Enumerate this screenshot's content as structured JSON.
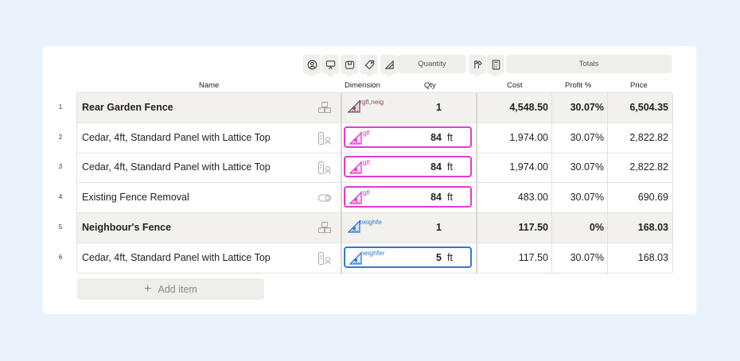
{
  "toolbar": {
    "quantity_label": "Quantity",
    "totals_label": "Totals"
  },
  "columns": {
    "name": "Name",
    "dimension": "Dimension",
    "qty": "Qty",
    "cost": "Cost",
    "profit": "Profit %",
    "price": "Price"
  },
  "rows": [
    {
      "num": "1",
      "name": "Rear Garden Fence",
      "group": true,
      "dimension": "rgfl,neig",
      "dim_color": "#8a4b6b",
      "qty": "1",
      "unit": "",
      "cost": "4,548.50",
      "profit": "30.07%",
      "price": "6,504.35",
      "icon": "boxes-icon"
    },
    {
      "num": "2",
      "name": "Cedar, 4ft, Standard Panel with Lattice Top",
      "group": false,
      "dimension": "rgfl",
      "dim_color": "#e637d6",
      "qty": "84",
      "unit": "ft",
      "cost": "1,974.00",
      "profit": "30.07%",
      "price": "2,822.82",
      "icon": "material-labor-icon"
    },
    {
      "num": "3",
      "name": "Cedar, 4ft, Standard Panel with Lattice Top",
      "group": false,
      "dimension": "rgfl",
      "dim_color": "#e637d6",
      "qty": "84",
      "unit": "ft",
      "cost": "1,974.00",
      "profit": "30.07%",
      "price": "2,822.82",
      "icon": "material-labor-icon"
    },
    {
      "num": "4",
      "name": "Existing Fence Removal",
      "group": false,
      "dimension": "rgfl",
      "dim_color": "#e637d6",
      "qty": "84",
      "unit": "ft",
      "cost": "483.00",
      "profit": "30.07%",
      "price": "690.69",
      "icon": "toggle-icon"
    },
    {
      "num": "5",
      "name": "Neighbour's Fence",
      "group": true,
      "dimension": "neighfe",
      "dim_color": "#2e7bd1",
      "qty": "1",
      "unit": "",
      "cost": "117.50",
      "profit": "0%",
      "price": "168.03",
      "icon": "boxes-icon"
    },
    {
      "num": "6",
      "name": "Cedar, 4ft, Standard Panel with Lattice Top",
      "group": false,
      "dimension": "neighfer",
      "dim_color": "#2e7bd1",
      "qty": "5",
      "unit": "ft",
      "cost": "117.50",
      "profit": "30.07%",
      "price": "168.03",
      "icon": "material-labor-icon"
    }
  ],
  "add_item": {
    "icon": "+",
    "label": "Add item"
  }
}
